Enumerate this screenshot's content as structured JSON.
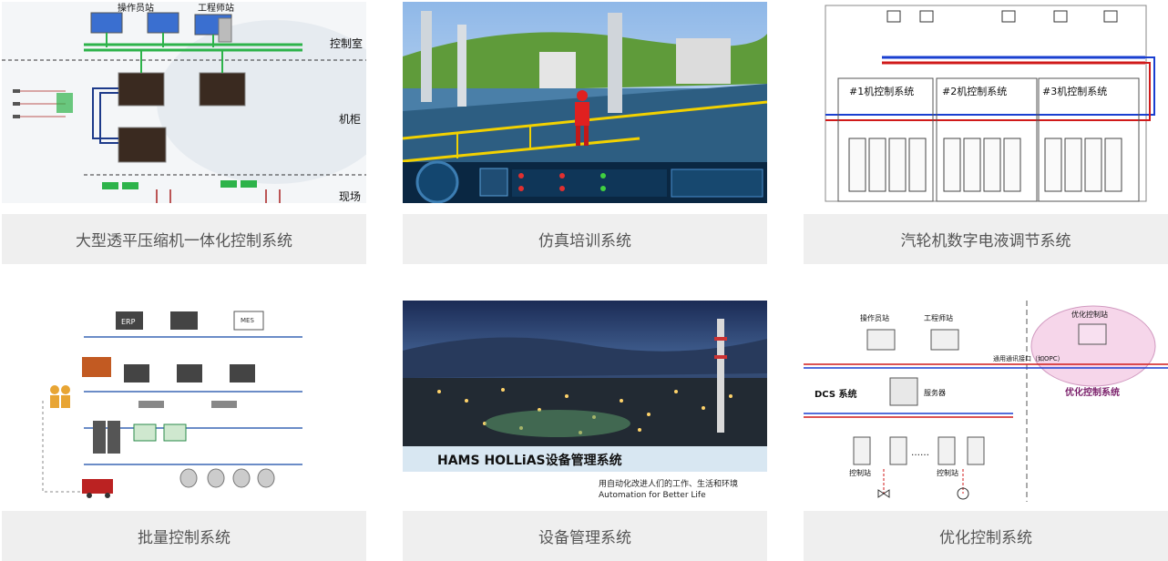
{
  "cards": [
    {
      "title": "大型透平压缩机一体化控制系统",
      "labels": {
        "operator_station": "操作员站",
        "engineer_station": "工程师站",
        "control_room": "控制室",
        "cabinet": "机柜",
        "field": "现场"
      }
    },
    {
      "title": "仿真培训系统"
    },
    {
      "title": "汽轮机数字电液调节系统",
      "labels": {
        "unit1": "#1机控制系统",
        "unit2": "#2机控制系统",
        "unit3": "#3机控制系统"
      }
    },
    {
      "title": "批量控制系统",
      "labels": {
        "erp": "ERP",
        "mes": "MES"
      }
    },
    {
      "title": "设备管理系统",
      "labels": {
        "banner": "HAMS HOLLiAS设备管理系统",
        "slogan_cn": "用自动化改进人们的工作、生活和环境",
        "slogan_en": "Automation for Better Life"
      }
    },
    {
      "title": "优化控制系统",
      "labels": {
        "operator_station": "操作员站",
        "engineer_station": "工程师站",
        "opt_station": "优化控制站",
        "opt_system": "优化控制系统",
        "comm_port": "通用通讯接口（如OPC）",
        "dcs": "DCS 系统",
        "server": "服务器",
        "control_station": "控制站",
        "dots": "……"
      }
    }
  ]
}
